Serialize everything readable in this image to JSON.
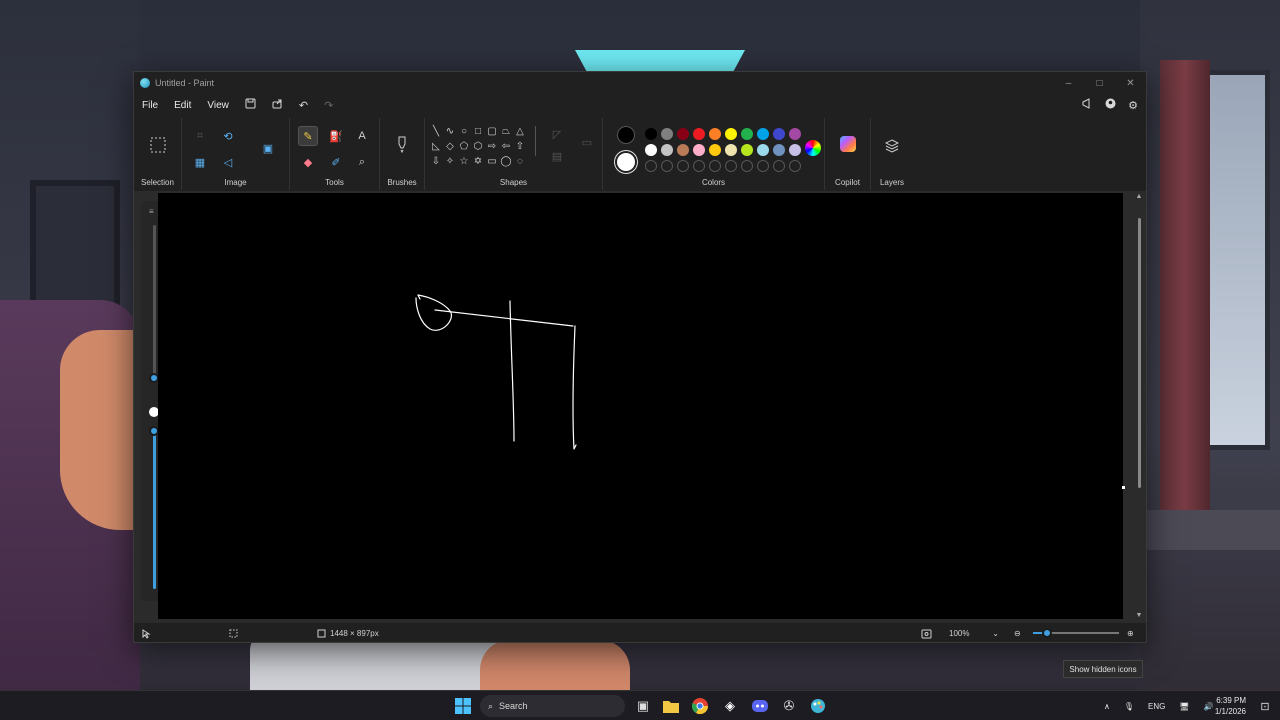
{
  "window": {
    "title": "Untitled - Paint",
    "controls": {
      "minimize": "–",
      "maximize": "□",
      "close": "✕"
    }
  },
  "menu": {
    "items": [
      "File",
      "Edit",
      "View"
    ]
  },
  "ribbon": {
    "groups": {
      "selection": "Selection",
      "image": "Image",
      "tools": "Tools",
      "brushes": "Brushes",
      "shapes": "Shapes",
      "colors": "Colors",
      "copilot": "Copilot",
      "layers": "Layers"
    },
    "text_tool_glyph": "A"
  },
  "colors": {
    "primary": "#000000",
    "secondary": "#ffffff",
    "palette_row1": [
      "#000000",
      "#7f7f7f",
      "#880015",
      "#ed1c24",
      "#ff7f27",
      "#fff200",
      "#22b14c",
      "#00a2e8",
      "#3f48cc",
      "#a349a4"
    ],
    "palette_row2": [
      "#ffffff",
      "#c3c3c3",
      "#b97a57",
      "#ffaec9",
      "#ffc90e",
      "#efe4b0",
      "#b5e61d",
      "#99d9ea",
      "#7092be",
      "#c8bfe7"
    ]
  },
  "canvas": {
    "background": "#000000",
    "stroke_color": "#ffffff"
  },
  "status": {
    "canvas_size": "1448 × 897px",
    "zoom": "100%",
    "zoom_level": 0.16
  },
  "tooltip": "Show hidden icons",
  "taskbar": {
    "search_placeholder": "Search",
    "language": "ENG",
    "time": "6:39 PM",
    "date": "1/1/2026"
  }
}
